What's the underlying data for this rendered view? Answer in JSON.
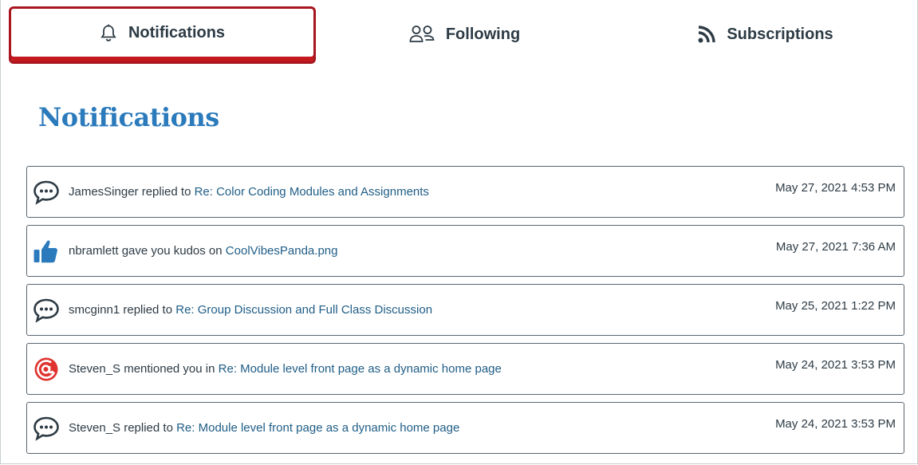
{
  "tabs": [
    {
      "label": "Notifications",
      "icon": "bell-icon",
      "selected": true
    },
    {
      "label": "Following",
      "icon": "people-icon",
      "selected": false
    },
    {
      "label": "Subscriptions",
      "icon": "rss-icon",
      "selected": false
    }
  ],
  "colors": {
    "accent": "#2b7abc",
    "link": "#1f5d86",
    "selected_border": "#a8151e",
    "mention": "#e0332f",
    "kudos": "#2b7abc"
  },
  "page_title": "Notifications",
  "notifications": [
    {
      "icon": "speech-bubble-icon",
      "text": "JamesSinger replied to",
      "link": "Re: Color Coding Modules and Assignments",
      "time": "May 27, 2021 4:53 PM"
    },
    {
      "icon": "thumbs-up-icon",
      "text": "nbramlett gave you kudos on",
      "link": "CoolVibesPanda.png",
      "time": "May 27, 2021 7:36 AM"
    },
    {
      "icon": "speech-bubble-icon",
      "text": "smcginn1 replied to",
      "link": "Re: Group Discussion and Full Class Discussion",
      "time": "May 25, 2021 1:22 PM"
    },
    {
      "icon": "at-mention-icon",
      "text": "Steven_S mentioned you in",
      "link": "Re: Module level front page as a dynamic home page",
      "time": "May 24, 2021 3:53 PM"
    },
    {
      "icon": "speech-bubble-icon",
      "text": "Steven_S replied to",
      "link": "Re: Module level front page as a dynamic home page",
      "time": "May 24, 2021 3:53 PM"
    }
  ]
}
